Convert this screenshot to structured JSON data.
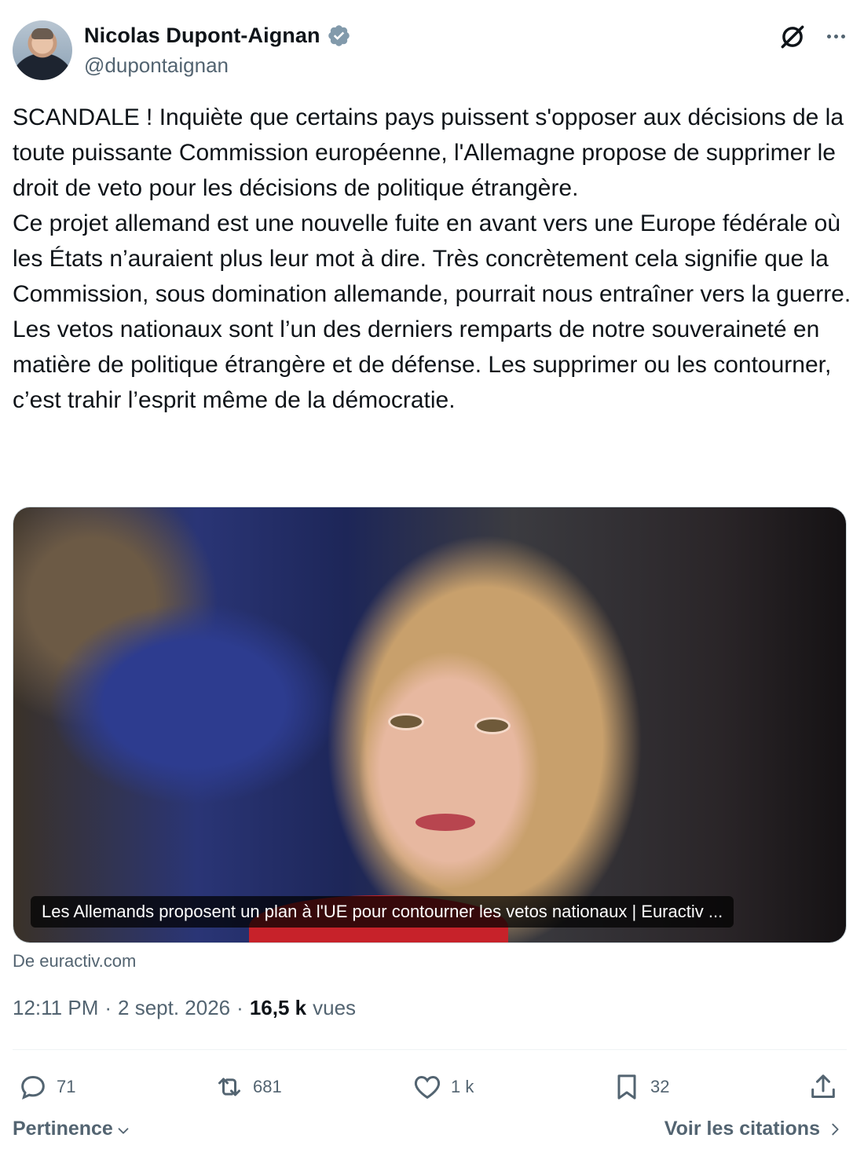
{
  "author": {
    "name": "Nicolas Dupont-Aignan",
    "handle": "@dupontaignan",
    "verified": true
  },
  "tweet": {
    "paragraphs": [
      "SCANDALE ! Inquiète que certains pays puissent s'opposer aux décisions de la toute puissante Commission européenne, l'Allemagne propose de supprimer le droit de veto pour les décisions de politique étrangère.",
      "Ce projet allemand est une nouvelle fuite en avant vers une Europe fédérale où les États n’auraient plus leur mot à dire. Très concrètement cela signifie que la Commission, sous domination allemande, pourrait nous entraîner vers la guerre. Les vetos nationaux sont l’un des derniers remparts de notre souveraineté en matière de politique étrangère et de défense. Les supprimer ou les contourner, c’est trahir l’esprit même de la démocratie."
    ]
  },
  "card": {
    "caption": "Les Allemands proposent un plan à l'UE pour contourner les vetos nationaux | Euractiv ...",
    "source": "De euractiv.com"
  },
  "meta": {
    "time": "12:11 PM",
    "date": "2 sept. 2026",
    "separator": "·",
    "views_count": "16,5 k",
    "views_label": "vues"
  },
  "actions": {
    "replies": "71",
    "reposts": "681",
    "likes": "1 k",
    "bookmarks": "32"
  },
  "footer": {
    "sort_label": "Pertinence",
    "quotes_label": "Voir les citations"
  },
  "icons": {
    "verified": "verified-badge-icon",
    "grok": "grok-icon",
    "more": "more-icon",
    "reply": "reply-icon",
    "repost": "repost-icon",
    "like": "heart-icon",
    "bookmark": "bookmark-icon",
    "share": "share-icon"
  },
  "colors": {
    "text": "#0f1419",
    "secondary": "#536471",
    "verified_badge": "#829aab",
    "border": "#cfd9de"
  }
}
